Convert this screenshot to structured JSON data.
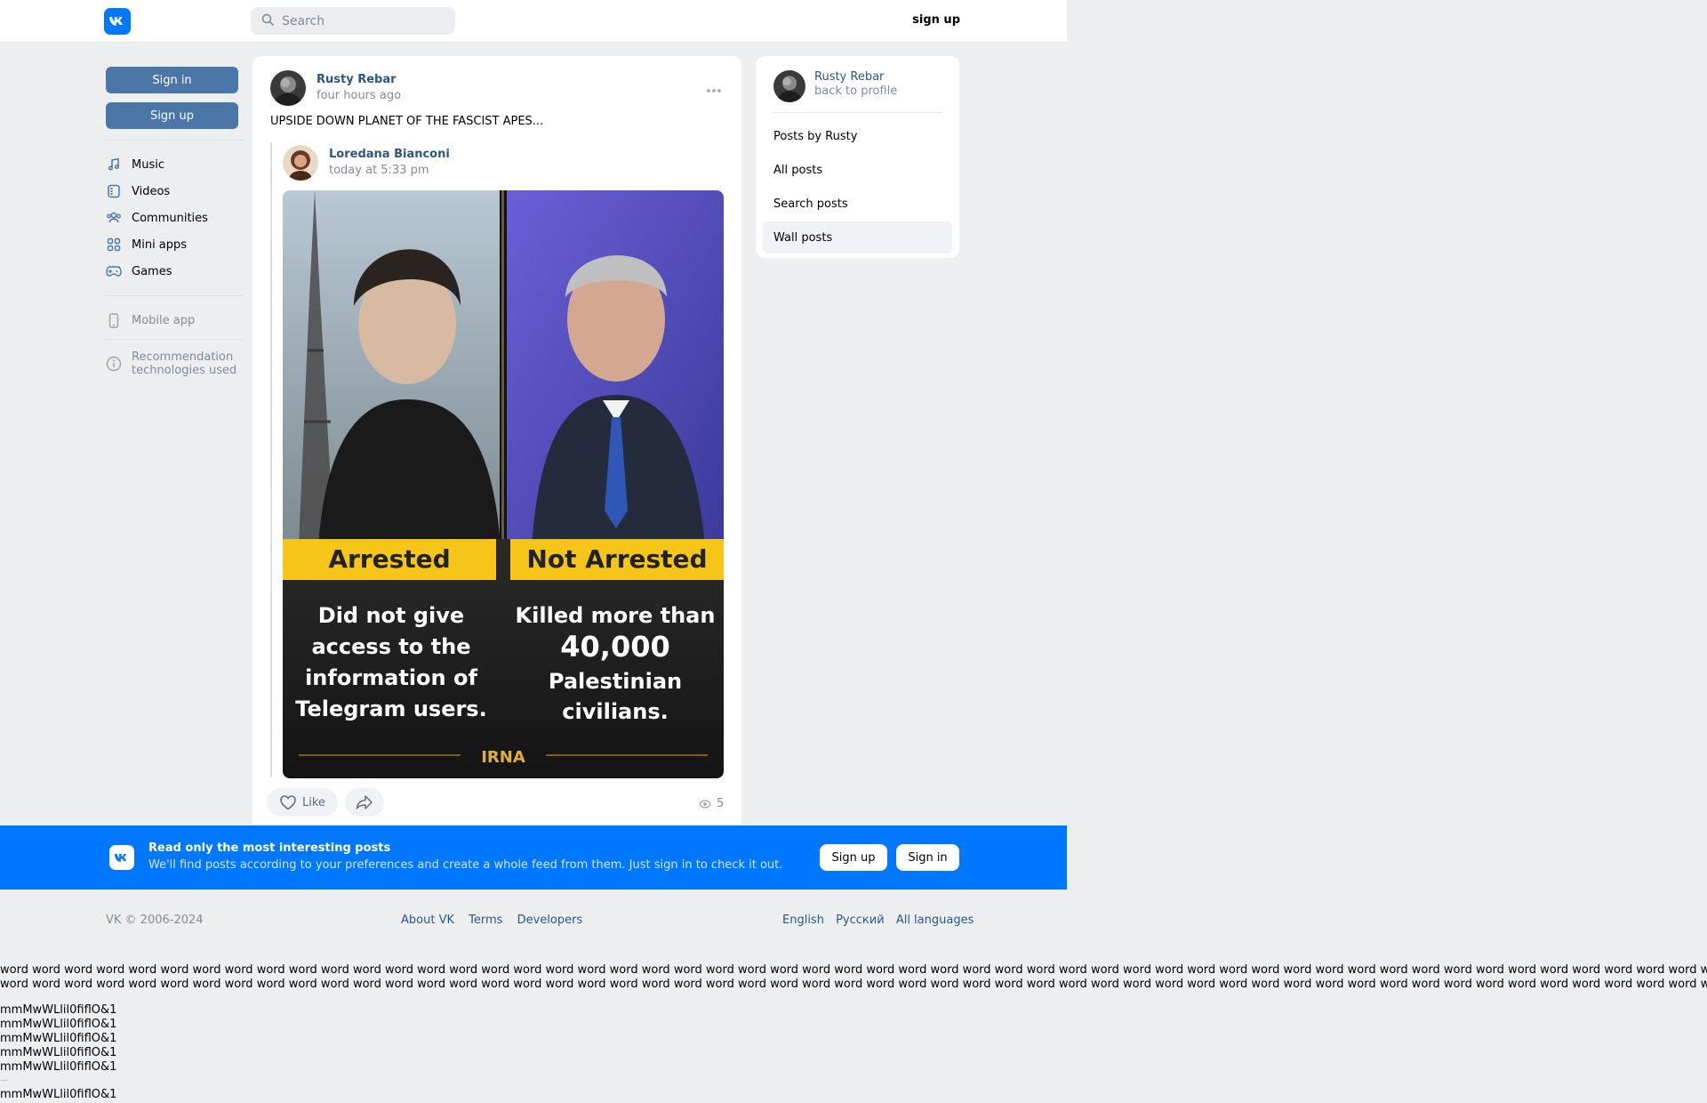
{
  "header": {
    "search_placeholder": "Search",
    "signup_label": "sign up"
  },
  "left_menu": {
    "sign_in": "Sign in",
    "sign_up": "Sign up",
    "items": [
      {
        "label": "Music",
        "icon": "music-icon"
      },
      {
        "label": "Videos",
        "icon": "video-icon"
      },
      {
        "label": "Communities",
        "icon": "communities-icon"
      },
      {
        "label": "Mini apps",
        "icon": "mini-apps-icon"
      },
      {
        "label": "Games",
        "icon": "games-icon"
      }
    ],
    "mobile_app": "Mobile app",
    "recommendation_line1": "Recommendation",
    "recommendation_line2": "technologies used"
  },
  "post": {
    "author": "Rusty Rebar",
    "time": "four hours ago",
    "text": "UPSIDE DOWN PLANET OF THE FASCIST APES...",
    "repost_author": "Loredana Bianconi",
    "repost_time": "today at 5:33 pm",
    "image": {
      "left_label": "Arrested",
      "right_label": "Not Arrested",
      "left_line1": "Did not give",
      "left_line2": "access to the",
      "left_line3": "information of",
      "left_line4": "Telegram users.",
      "right_line1": "Killed more than",
      "right_line2": "40,000",
      "right_line3": "Palestinian",
      "right_line4": "civilians.",
      "brand": "IRNA"
    },
    "like_label": "Like",
    "views": "5"
  },
  "right_panel": {
    "name": "Rusty Rebar",
    "back": "back to profile",
    "items": [
      "Posts by Rusty",
      "All posts",
      "Search posts",
      "Wall posts"
    ]
  },
  "banner": {
    "title": "Read only the most interesting posts",
    "subtitle": "We'll find posts according to your preferences and create a whole feed from them. Just sign in to check it out.",
    "signup": "Sign up",
    "signin": "Sign in"
  },
  "footer": {
    "copyright": "VK © 2006-2024",
    "links": [
      "About VK",
      "Terms",
      "Developers"
    ],
    "langs": [
      "English",
      "Русский",
      "All languages"
    ]
  },
  "junk": {
    "words_line": "word word word word word word word word word word word word word word word word word word word word word word word word word word word word word word word word word word word word word word word word word word word word word word word word word word word word word word word word word word word word word word word word word word word word word word word word word word word word word word word word word word word word word",
    "chars_line": "mmMwWLlil0fiflO&1",
    "dash": "—"
  }
}
